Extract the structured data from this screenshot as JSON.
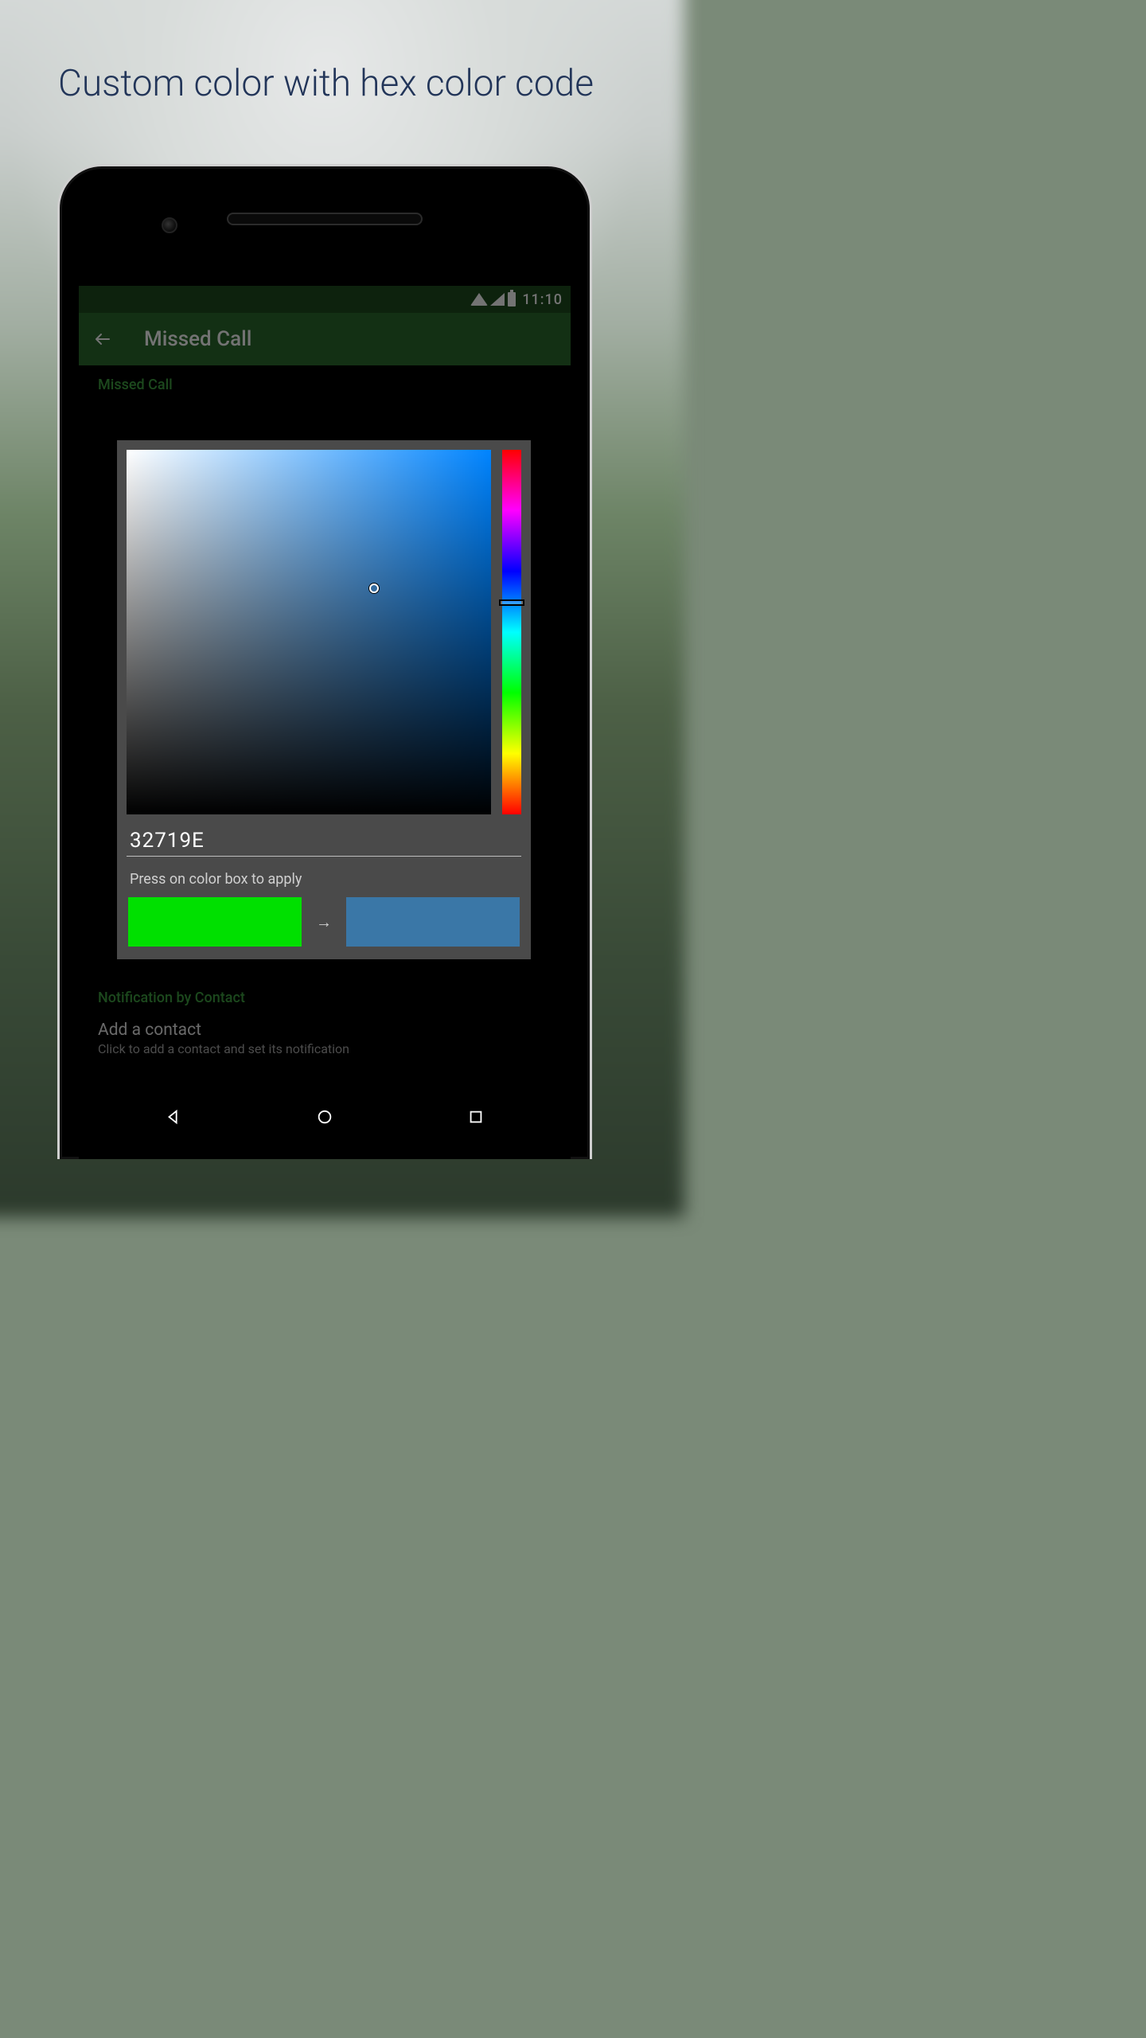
{
  "headline": "Custom color with hex color code",
  "statusbar": {
    "time": "11:10"
  },
  "appbar": {
    "title": "Missed Call"
  },
  "page": {
    "section1_label": "Missed Call",
    "section2_label": "Notification by Contact",
    "add_contact": {
      "title": "Add a contact",
      "subtitle": "Click to add a contact and set its notification"
    }
  },
  "picker": {
    "hex_value": "32719E",
    "apply_hint": "Press on color box to apply",
    "arrow": "→",
    "from_color": "#00e000",
    "to_color": "#3a77a7"
  }
}
